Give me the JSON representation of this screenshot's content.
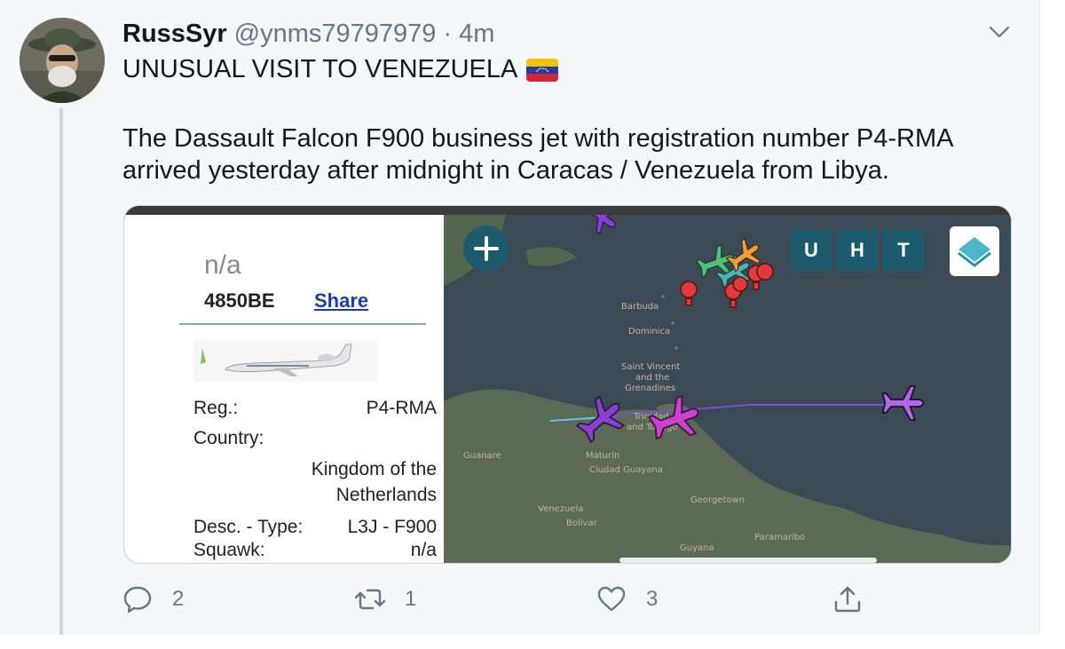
{
  "tweet": {
    "author_name": "RussSyr",
    "author_handle": "@ynms79797979",
    "separator": "·",
    "time": "4m",
    "headline": "UNUSUAL VISIT TO VENEZUELA",
    "flag_icon": "venezuela-flag-icon",
    "body_lines": [
      "The Dassault Falcon F900 business jet with registration number P4-RMA",
      "arrived yesterday after midnight in Caracas / Venezuela from Libya."
    ]
  },
  "card": {
    "panel": {
      "callsign": "n/a",
      "hex": "4850BE",
      "share_label": "Share",
      "rows": [
        {
          "label": "Reg.:",
          "value": "P4-RMA"
        },
        {
          "label": "Country:",
          "value_lines": [
            "Kingdom of the",
            "Netherlands"
          ]
        },
        {
          "label": "Desc. - Type:",
          "value": "L3J - F900"
        },
        {
          "label": "Squawk:",
          "value": "n/a"
        }
      ]
    },
    "map": {
      "buttons": [
        "U",
        "H",
        "T"
      ],
      "labels": [
        "Dominica",
        "Saint Vincent",
        "and the",
        "Grenadines",
        "Trinidad",
        "and Tobago",
        "Maturín",
        "Ciudad Guayana",
        "Georgetown",
        "Paramaribo",
        "Venezuela",
        "Bolívar",
        "Guyana",
        "Guanare",
        "Barbuda"
      ]
    }
  },
  "actions": {
    "reply_count": "2",
    "retweet_count": "1",
    "like_count": "3"
  },
  "colors": {
    "background": "#f5f8fa",
    "muted": "#657786",
    "map_button": "#1c5b6d",
    "map_water": "#3b4a54",
    "track": "#7b4fd0"
  }
}
